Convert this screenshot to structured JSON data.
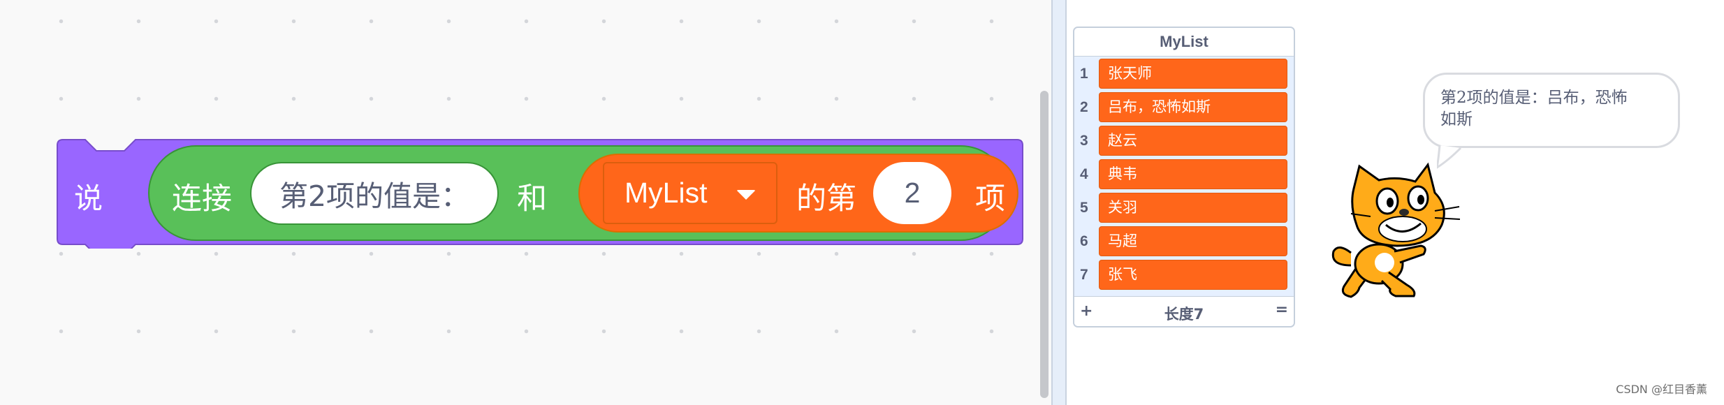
{
  "code_area": {
    "say_block": {
      "label": "说",
      "color": "#9966ff",
      "join_block": {
        "label": "连接",
        "color": "#59c059",
        "text_input": "第2项的值是：",
        "and_label": "和",
        "item_block": {
          "color": "#ff6619",
          "list_name": "MyList",
          "of_label": "的第",
          "index": "2",
          "item_label": "项"
        }
      }
    }
  },
  "stage": {
    "list_monitor": {
      "title": "MyList",
      "items": [
        {
          "index": "1",
          "value": "张天师"
        },
        {
          "index": "2",
          "value": "吕布，恐怖如斯"
        },
        {
          "index": "3",
          "value": "赵云"
        },
        {
          "index": "4",
          "value": "典韦"
        },
        {
          "index": "5",
          "value": "关羽"
        },
        {
          "index": "6",
          "value": "马超"
        },
        {
          "index": "7",
          "value": "张飞"
        }
      ],
      "add_symbol": "+",
      "length_label": "长度7",
      "resize_symbol": "="
    },
    "speech_bubble": {
      "line1": "第2项的值是：吕布，恐怖",
      "line2": "如斯"
    },
    "sprite": "scratch-cat-icon"
  },
  "watermark": "CSDN @红目香薰"
}
